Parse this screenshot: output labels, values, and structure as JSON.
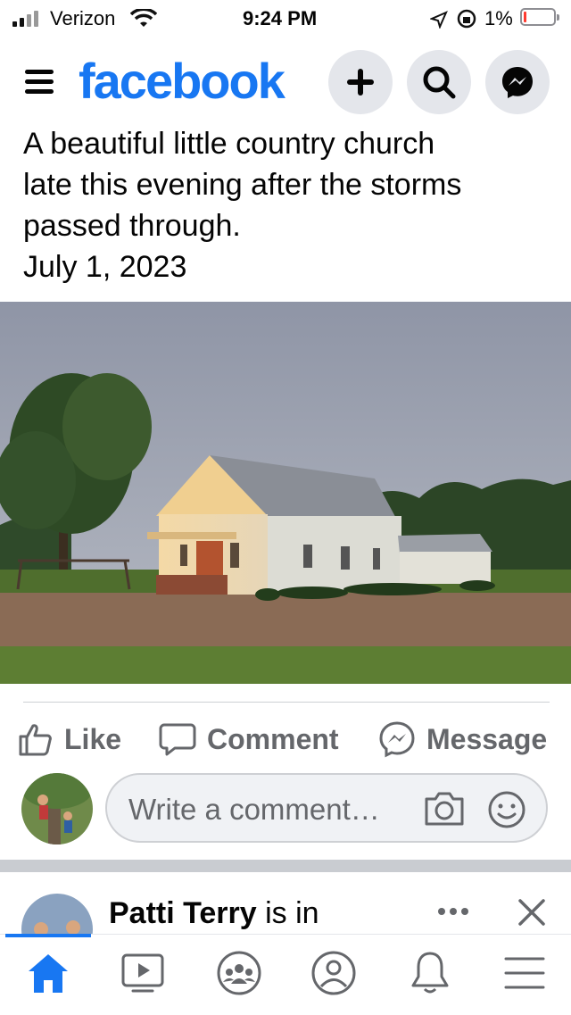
{
  "status_bar": {
    "carrier": "Verizon",
    "time": "9:24 PM",
    "battery": "1%"
  },
  "header": {
    "logo": "facebook",
    "actions": [
      "plus-icon",
      "search-icon",
      "messenger-icon"
    ]
  },
  "post": {
    "text": "A beautiful little country church late this evening after the storms passed through. July 1, 2023",
    "text_lines": [
      "A beautiful little country church",
      "late this evening after the storms",
      "passed through.",
      "July 1, 2023"
    ],
    "photo_subject": "white country church at sunset"
  },
  "actions": {
    "like": "Like",
    "comment": "Comment",
    "message": "Message"
  },
  "comment_input": {
    "placeholder": "Write a comment…"
  },
  "next_post": {
    "author": "Patti Terry",
    "suffix": " is in"
  },
  "tabs": [
    "home-icon",
    "video-icon",
    "groups-icon",
    "profile-icon",
    "notifications-icon",
    "menu-icon"
  ],
  "colors": {
    "brand": "#1877f2",
    "muted_text": "#65676b",
    "input_bg": "#f0f2f5"
  }
}
